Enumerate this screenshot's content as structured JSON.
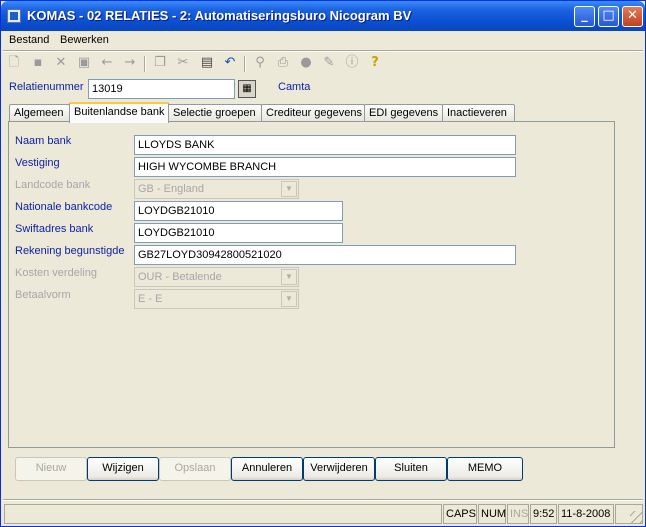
{
  "window": {
    "title": "KOMAS - 02 RELATIES - 2: Automatiseringsburo Nicogram BV",
    "minimize": "_",
    "maximize": "□",
    "close": "✕"
  },
  "menu": {
    "bestand": "Bestand",
    "bewerken": "Bewerken"
  },
  "toolbar": {
    "icons": [
      "new-icon",
      "save-icon",
      "delete-icon",
      "save-as-icon",
      "back-arrow-icon",
      "forward-arrow-icon",
      "copy-icon",
      "cut-icon",
      "paste-icon",
      "undo-icon",
      "binoculars-icon",
      "print-icon",
      "user-icon",
      "notes-icon",
      "info-icon",
      "help-icon"
    ]
  },
  "relatie": {
    "label": "Relatienummer",
    "value": "13019",
    "name": "Camta"
  },
  "tabs": [
    {
      "label": "Algemeen"
    },
    {
      "label": "Buitenlandse bank"
    },
    {
      "label": "Selectie groepen"
    },
    {
      "label": "Crediteur gegevens"
    },
    {
      "label": "EDI gegevens"
    },
    {
      "label": "Inactieveren"
    }
  ],
  "form": {
    "naam_bank": {
      "label": "Naam bank",
      "value": "LLOYDS BANK"
    },
    "vestiging": {
      "label": "Vestiging",
      "value": "HIGH WYCOMBE BRANCH"
    },
    "landcode": {
      "label": "Landcode bank",
      "value": "GB - England"
    },
    "nationale_bankcode": {
      "label": "Nationale bankcode",
      "value": "LOYDGB21010"
    },
    "swiftadres": {
      "label": "Swiftadres bank",
      "value": "LOYDGB21010"
    },
    "rekening": {
      "label": "Rekening begunstigde",
      "value": "GB27LOYD30942800521020"
    },
    "kosten": {
      "label": "Kosten verdeling",
      "value": "OUR - Betalende"
    },
    "betaalvorm": {
      "label": "Betaalvorm",
      "value": "E - E"
    }
  },
  "buttons": {
    "nieuw": "Nieuw",
    "wijzigen": "Wijzigen",
    "opslaan": "Opslaan",
    "annuleren": "Annuleren",
    "verwijderen": "Verwijderen",
    "sluiten": "Sluiten",
    "memo": "MEMO"
  },
  "status": {
    "caps": "CAPS",
    "num": "NUM",
    "ins": "INS",
    "time": "9:52",
    "date": "11-8-2008"
  },
  "colors": {
    "title_blue": "#0A4FD0",
    "label_blue": "#0B1FA8",
    "face": "#ECE9D8"
  }
}
